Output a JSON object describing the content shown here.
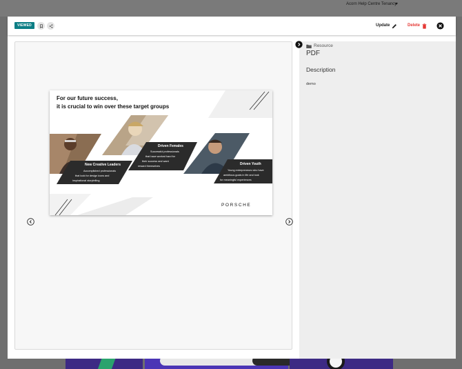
{
  "background": {
    "tenancy_name": "Acorn Help Centre Tenancy"
  },
  "header": {
    "status_badge": "VIEWED",
    "update_label": "Update",
    "delete_label": "Delete"
  },
  "side_panel": {
    "category": "Resource",
    "type": "PDF",
    "description_heading": "Description",
    "description": "demo"
  },
  "slide": {
    "title_line1": "For our future success,",
    "title_line2": "it is crucial to win over these target groups",
    "groups": [
      {
        "name": "New Creative Leaders",
        "lines": [
          "Accomplished professionals",
          "that look for design icons and",
          "inspirational storytelling"
        ]
      },
      {
        "name": "Driven Females",
        "lines": [
          "Successful professionals",
          "that have worked hard for",
          "their success and want",
          "reward themselves"
        ]
      },
      {
        "name": "Driven Youth",
        "lines": [
          "Young entrepreneurs who have",
          "ambitious goals in life and look",
          "for meaningful experiences"
        ]
      }
    ],
    "brand": "PORSCHE"
  },
  "colors": {
    "badge": "#0c7e85",
    "delete": "#e53935",
    "panel": "#eeeeee",
    "slide_dark": "#2b2b2b"
  }
}
